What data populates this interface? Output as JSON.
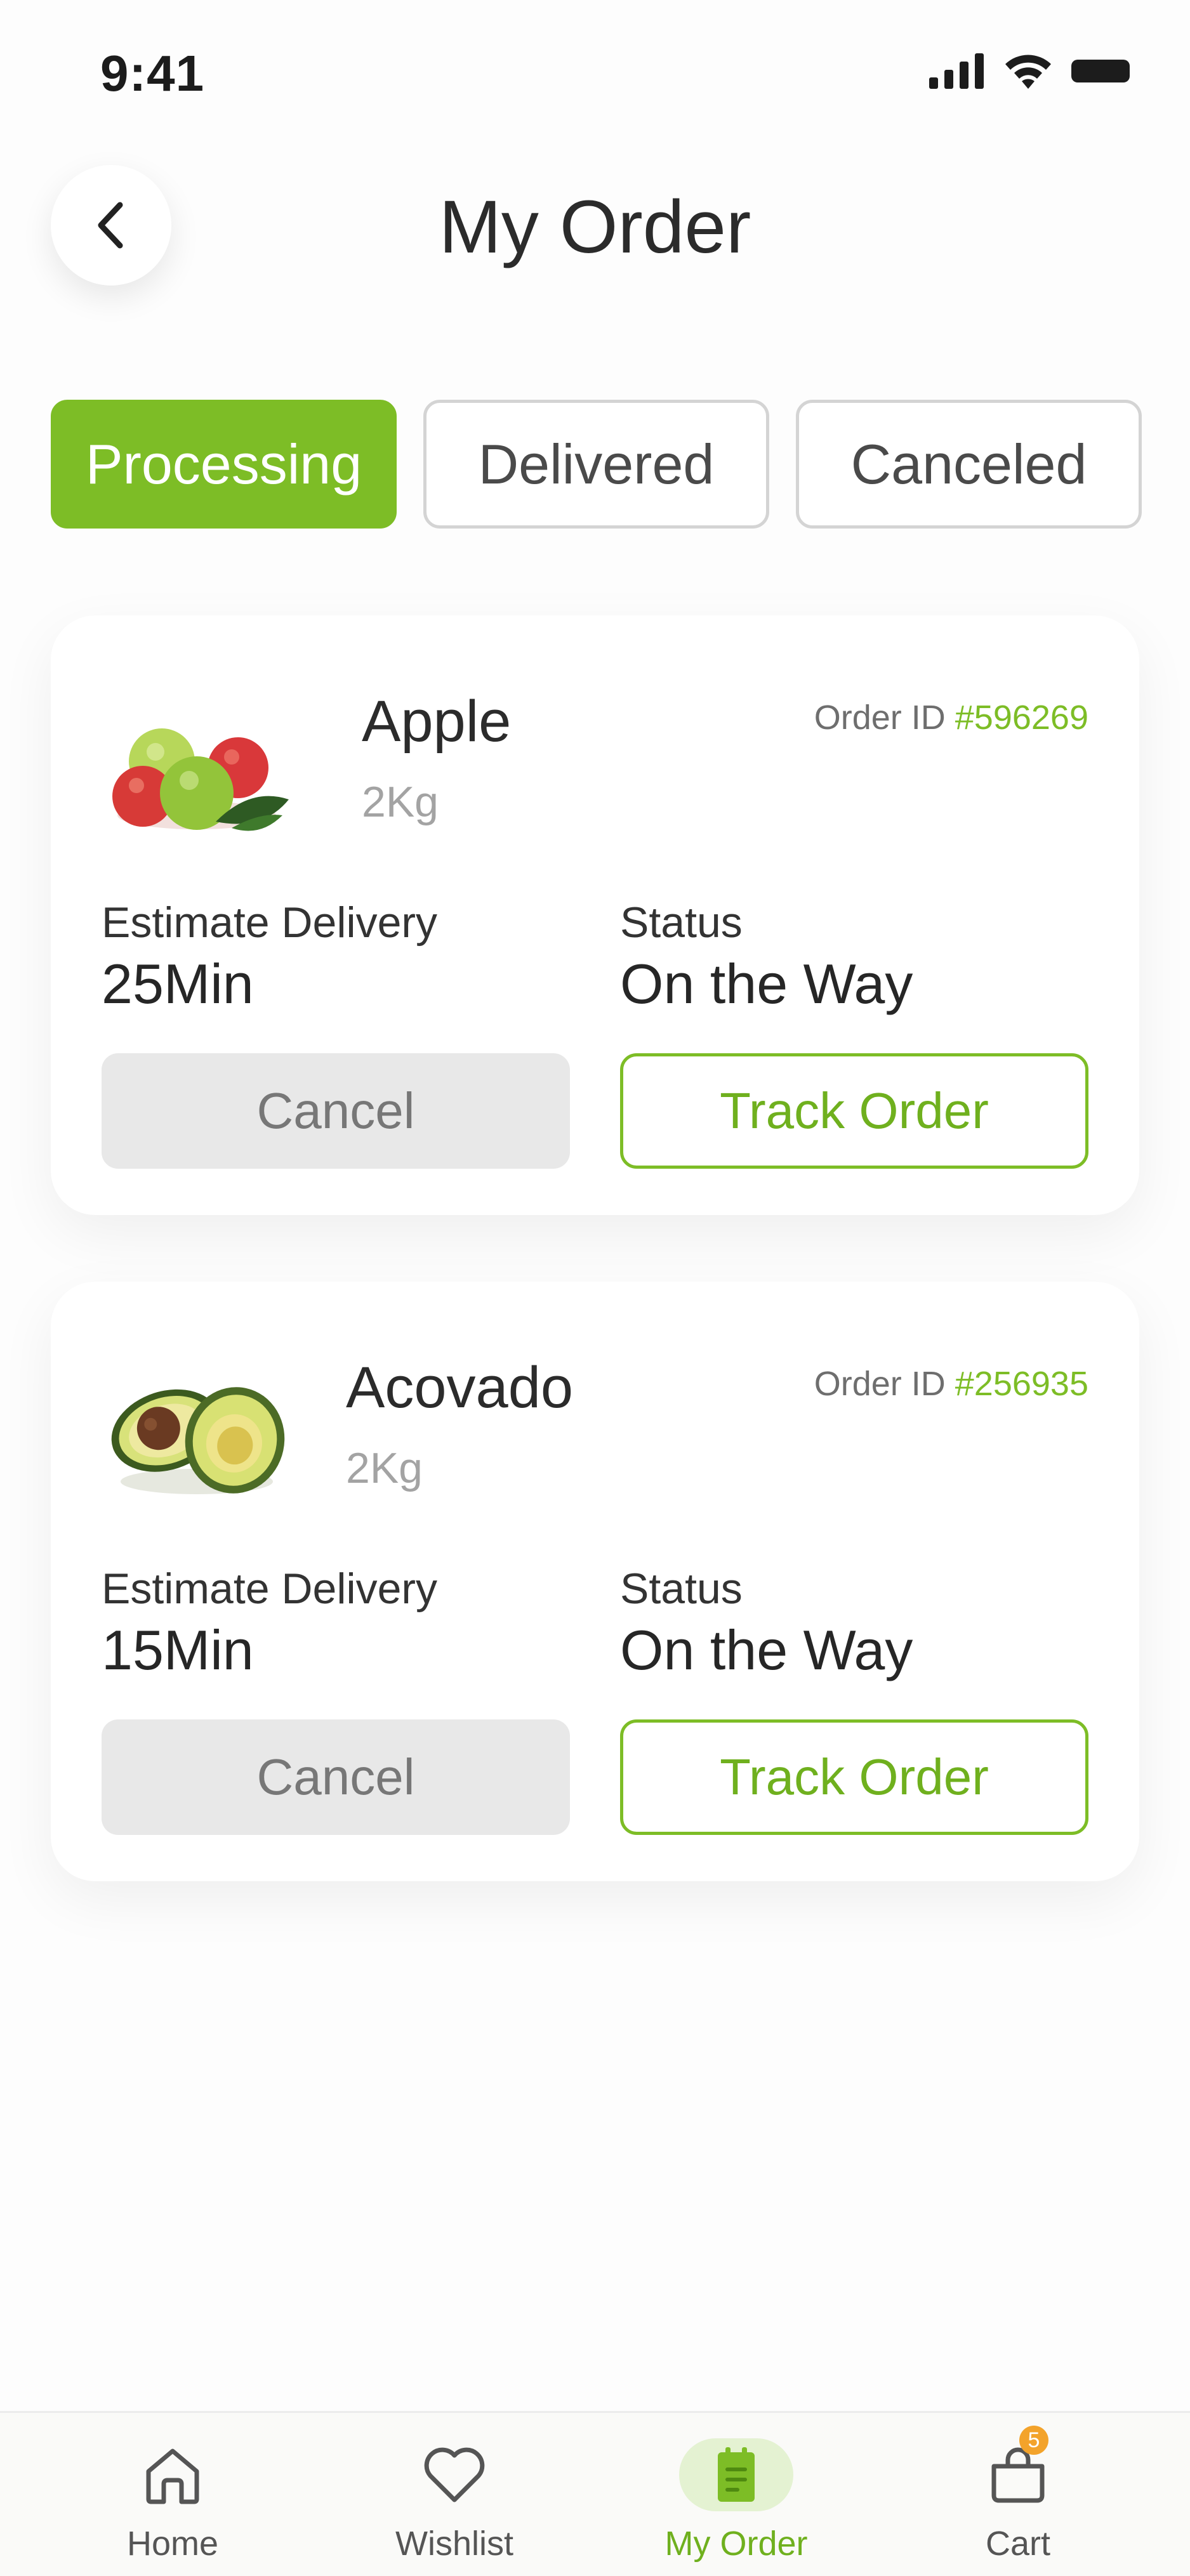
{
  "status_bar": {
    "time": "9:41"
  },
  "header": {
    "title": "My Order"
  },
  "tabs": [
    {
      "label": "Processing",
      "active": true
    },
    {
      "label": "Delivered",
      "active": false
    },
    {
      "label": "Canceled",
      "active": false
    }
  ],
  "orders": [
    {
      "product": "Apple",
      "weight": "2Kg",
      "order_id_label": "Order ID",
      "order_id": "#596269",
      "estimate_label": "Estimate Delivery",
      "estimate_value": "25Min",
      "status_label": "Status",
      "status_value": "On the Way",
      "cancel_label": "Cancel",
      "track_label": "Track Order"
    },
    {
      "product": "Acovado",
      "weight": "2Kg",
      "order_id_label": "Order ID",
      "order_id": "#256935",
      "estimate_label": "Estimate Delivery",
      "estimate_value": "15Min",
      "status_label": "Status",
      "status_value": "On the Way",
      "cancel_label": "Cancel",
      "track_label": "Track Order"
    }
  ],
  "bottom_nav": [
    {
      "label": "Home",
      "icon": "home-icon",
      "active": false
    },
    {
      "label": "Wishlist",
      "icon": "heart-icon",
      "active": false
    },
    {
      "label": "My Order",
      "icon": "order-list-icon",
      "active": true
    },
    {
      "label": "Cart",
      "icon": "cart-bag-icon",
      "active": false,
      "badge": "5"
    }
  ],
  "colors": {
    "accent": "#7dbd26",
    "badge": "#f3a32b",
    "muted": "#a3a3a3"
  }
}
